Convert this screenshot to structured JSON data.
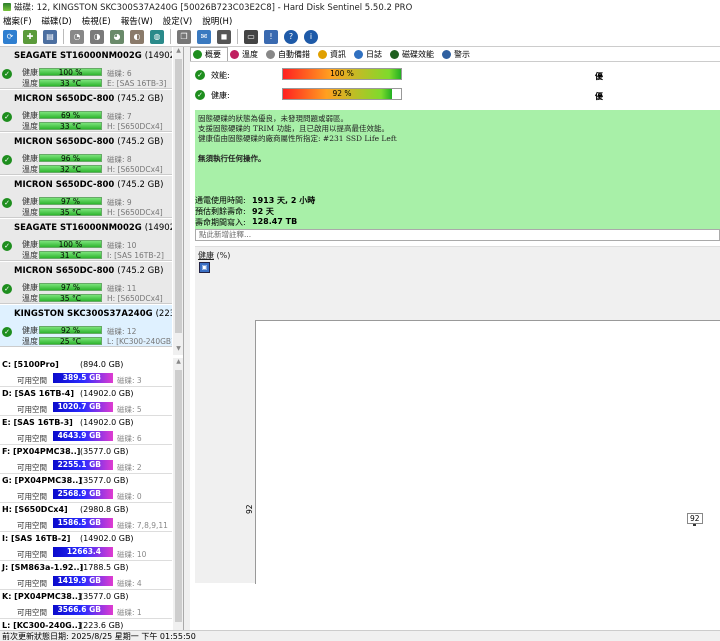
{
  "window": {
    "title": "磁碟: 12, KINGSTON SKC300S37A240G [50026B723C03E2C8] - Hard Disk Sentinel 5.50.2 PRO"
  },
  "menu": [
    "檔案(F)",
    "磁碟(D)",
    "檢視(E)",
    "報告(W)",
    "設定(V)",
    "說明(H)"
  ],
  "disks": [
    {
      "name": "SEAGATE ST16000NM002G",
      "size": "(14902.0 GB)",
      "health_label": "健康:",
      "health": "100 %",
      "health_pct": 100,
      "temp_label": "溫度:",
      "temp": "33 °C",
      "disk_no": "磁碟: 6",
      "drive": "E: [SAS 16TB-3]",
      "selected": false
    },
    {
      "name": "MICRON  S650DC-800",
      "size": "(745.2 GB)",
      "health_label": "健康:",
      "health": "69 %",
      "health_pct": 69,
      "temp_label": "溫度:",
      "temp": "33 °C",
      "disk_no": "磁碟: 7",
      "drive": "H: [S650DCx4]",
      "selected": false
    },
    {
      "name": "MICRON  S650DC-800",
      "size": "(745.2 GB)",
      "health_label": "健康:",
      "health": "96 %",
      "health_pct": 96,
      "temp_label": "溫度:",
      "temp": "32 °C",
      "disk_no": "磁碟: 8",
      "drive": "H: [S650DCx4]",
      "selected": false
    },
    {
      "name": "MICRON  S650DC-800",
      "size": "(745.2 GB)",
      "health_label": "健康:",
      "health": "97 %",
      "health_pct": 97,
      "temp_label": "溫度:",
      "temp": "35 °C",
      "disk_no": "磁碟: 9",
      "drive": "H: [S650DCx4]",
      "selected": false
    },
    {
      "name": "SEAGATE ST16000NM002G",
      "size": "(14902.0 GB)",
      "health_label": "健康:",
      "health": "100 %",
      "health_pct": 100,
      "temp_label": "溫度:",
      "temp": "31 °C",
      "disk_no": "磁碟: 10",
      "drive": "I: [SAS 16TB-2]",
      "selected": false
    },
    {
      "name": "MICRON  S650DC-800",
      "size": "(745.2 GB)",
      "health_label": "健康:",
      "health": "97 %",
      "health_pct": 97,
      "temp_label": "溫度:",
      "temp": "35 °C",
      "disk_no": "磁碟: 11",
      "drive": "H: [S650DCx4]",
      "selected": false
    },
    {
      "name": "KINGSTON SKC300S37A240G",
      "size": "(223.6 GB)",
      "health_label": "健康:",
      "health": "92 %",
      "health_pct": 92,
      "temp_label": "溫度:",
      "temp": "25 °C",
      "disk_no": "磁碟: 12",
      "drive": "L: [KC300-240GB]",
      "selected": true
    }
  ],
  "partitions": [
    {
      "name": "C: [5100Pro]",
      "size": "(894.0 GB)",
      "free_label": "可用空間",
      "free": "389.5 GB",
      "disk": "磁碟: 3"
    },
    {
      "name": "D: [SAS 16TB-4]",
      "size": "(14902.0 GB)",
      "free_label": "可用空間",
      "free": "1020.7 GB",
      "disk": "磁碟: 5"
    },
    {
      "name": "E: [SAS 16TB-3]",
      "size": "(14902.0 GB)",
      "free_label": "可用空間",
      "free": "4643.9 GB",
      "disk": "磁碟: 6"
    },
    {
      "name": "F: [PX04PMC38..]",
      "size": "(3577.0 GB)",
      "free_label": "可用空間",
      "free": "2255.1 GB",
      "disk": "磁碟: 2"
    },
    {
      "name": "G: [PX04PMC38..]",
      "size": "(3577.0 GB)",
      "free_label": "可用空間",
      "free": "2568.9 GB",
      "disk": "磁碟: 0"
    },
    {
      "name": "H: [S650DCx4]",
      "size": "(2980.8 GB)",
      "free_label": "可用空間",
      "free": "1586.5 GB",
      "disk": "磁碟: 7,8,9,11"
    },
    {
      "name": "I: [SAS 16TB-2]",
      "size": "(14902.0 GB)",
      "free_label": "可用空間",
      "free": "12663.4 GB",
      "disk": "磁碟: 10"
    },
    {
      "name": "J: [SM863a-1.92..]",
      "size": "(1788.5 GB)",
      "free_label": "可用空間",
      "free": "1419.9 GB",
      "disk": "磁碟: 4"
    },
    {
      "name": "K: [PX04PMC38..]",
      "size": "(3577.0 GB)",
      "free_label": "可用空間",
      "free": "3566.6 GB",
      "disk": "磁碟: 1"
    },
    {
      "name": "L: [KC300-240G..]",
      "size": "(223.6 GB)",
      "free_label": "",
      "free": "",
      "disk": ""
    }
  ],
  "tabs": [
    {
      "label": "概要",
      "icon": "check-icon",
      "color": "#1e8e1e"
    },
    {
      "label": "溫度",
      "icon": "thermometer-icon",
      "color": "#c02060"
    },
    {
      "label": "自動備錯",
      "icon": "wrench-icon",
      "color": "#888888"
    },
    {
      "label": "資訊",
      "icon": "info-icon",
      "color": "#e0a000"
    },
    {
      "label": "日誌",
      "icon": "log-icon",
      "color": "#3070c0"
    },
    {
      "label": "磁碟效能",
      "icon": "gauge-icon",
      "color": "#206020"
    },
    {
      "label": "警示",
      "icon": "alert-icon",
      "color": "#3060a0"
    }
  ],
  "overview": {
    "perf_label": "效能:",
    "perf_value": "100 %",
    "perf_pct": 100,
    "perf_rating": "優",
    "health_label": "健康:",
    "health_value": "92 %",
    "health_pct": 92,
    "health_rating": "優",
    "status_lines": [
      "固態硬碟的狀態為優良，未發現問題或弱區。",
      "支援固態硬碟的 TRIM 功能，且已啟用以提高最佳效能。",
      "健康值由固態硬碟的廠商屬性所指定: #231 SSD Life Left"
    ],
    "action": "無須執行任何操作。",
    "power_on_label": "通電使用時間:",
    "power_on": "1913 天, 2 小時",
    "lifetime_label": "預估剩餘壽命:",
    "lifetime": "92 天",
    "written_label": "壽命期間寫入:",
    "written": "128.47 TB",
    "notes_placeholder": "點此新增註釋..."
  },
  "chart": {
    "tab_label": "健康",
    "tab_unit": "(%)",
    "y_label": "92",
    "point_label": "92"
  },
  "chart_data": {
    "type": "line",
    "series": [
      {
        "values": [
          92
        ]
      }
    ]
  },
  "statusbar": {
    "text": "前次更新狀態日期: 2025/8/25 星期一 下午 01:55:50"
  },
  "colors": {
    "selected_bg": "#dff1ff",
    "status_green": "#a8f0a8"
  }
}
